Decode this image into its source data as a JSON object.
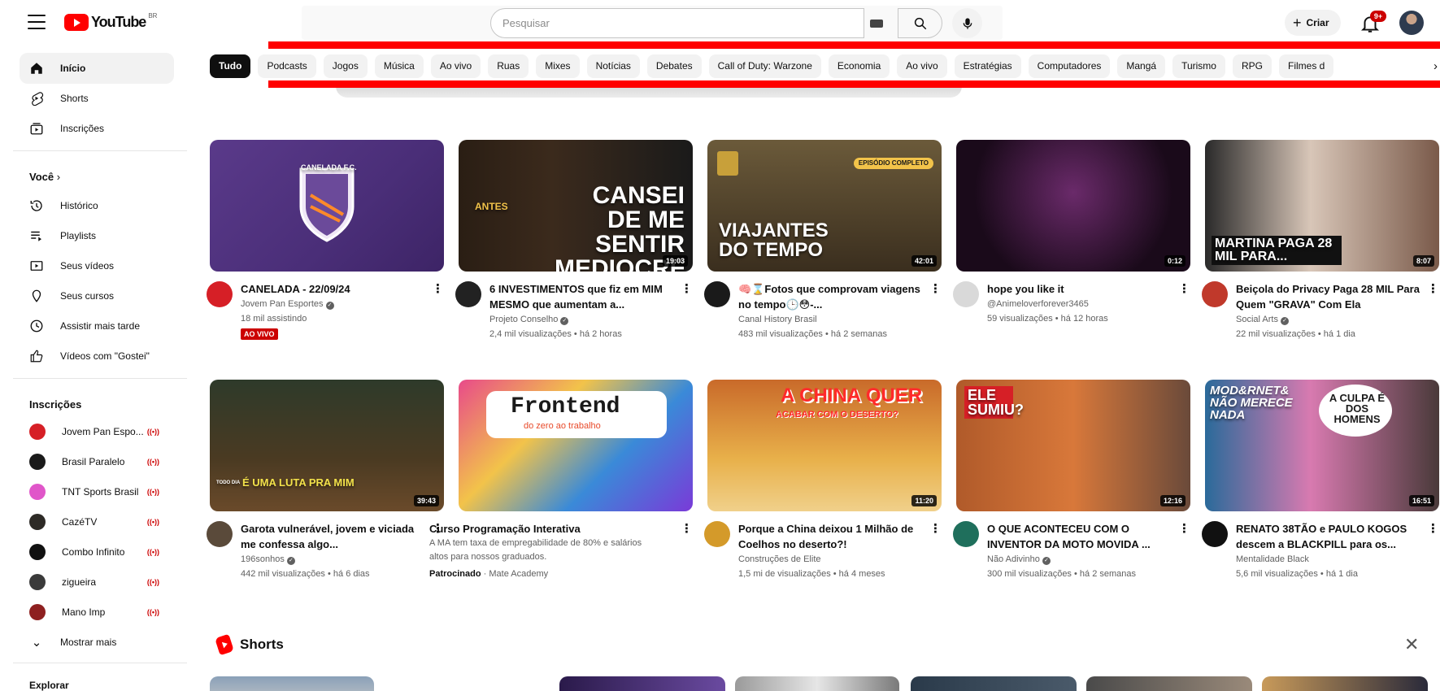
{
  "header": {
    "logo_text": "YouTube",
    "country_code": "BR",
    "search_placeholder": "Pesquisar",
    "create_label": "Criar",
    "notification_count": "9+"
  },
  "sidebar": {
    "main": [
      {
        "label": "Início",
        "icon": "home-icon",
        "active": true
      },
      {
        "label": "Shorts",
        "icon": "shorts-icon"
      },
      {
        "label": "Inscrições",
        "icon": "subscriptions-icon"
      }
    ],
    "you_heading": "Você",
    "you_items": [
      {
        "label": "Histórico",
        "icon": "history-icon"
      },
      {
        "label": "Playlists",
        "icon": "playlists-icon"
      },
      {
        "label": "Seus vídeos",
        "icon": "your-videos-icon"
      },
      {
        "label": "Seus cursos",
        "icon": "courses-icon"
      },
      {
        "label": "Assistir mais tarde",
        "icon": "watch-later-icon"
      },
      {
        "label": "Vídeos com \"Gostei\"",
        "icon": "liked-icon"
      }
    ],
    "subs_heading": "Inscrições",
    "subs": [
      {
        "label": "Jovem Pan Espo...",
        "color": "#d61f26",
        "live": true
      },
      {
        "label": "Brasil Paralelo",
        "color": "#1a1a1a",
        "live": true
      },
      {
        "label": "TNT Sports Brasil",
        "color": "#e056c9",
        "live": true
      },
      {
        "label": "CazéTV",
        "color": "#2d2a26",
        "live": true
      },
      {
        "label": "Combo Infinito",
        "color": "#111111",
        "live": true
      },
      {
        "label": "zigueira",
        "color": "#3a3a3a",
        "live": true
      },
      {
        "label": "Mano Imp",
        "color": "#8e2020",
        "live": true
      }
    ],
    "show_more": "Mostrar mais",
    "explore_heading": "Explorar"
  },
  "chips": [
    "Tudo",
    "Podcasts",
    "Jogos",
    "Música",
    "Ao vivo",
    "Ruas",
    "Mixes",
    "Notícias",
    "Debates",
    "Call of Duty: Warzone",
    "Economia",
    "Ao vivo",
    "Estratégias",
    "Computadores",
    "Mangá",
    "Turismo",
    "RPG",
    "Filmes d"
  ],
  "videos": [
    {
      "title": "CANELADA - 22/09/24",
      "channel": "Jovem Pan Esportes",
      "verified": true,
      "stats": "18 mil assistindo",
      "live_badge": "AO VIVO",
      "duration": "",
      "thumb_text": "CANELADA F.C.",
      "avatar_color": "#d61f26"
    },
    {
      "title": "6 INVESTIMENTOS que fiz em MIM MESMO que aumentam a...",
      "channel": "Projeto Conselho",
      "verified": true,
      "stats": "2,4 mil visualizações • há 2 horas",
      "duration": "19:03",
      "thumb_text": "CANSEI DE ME SENTIR MEDIOCRE",
      "thumb_extra": "ANTES",
      "avatar_color": "#222222"
    },
    {
      "title": "🧠⌛Fotos que comprovam viagens no tempo🕒😳-...",
      "channel": "Canal History Brasil",
      "verified": false,
      "stats": "483 mil visualizações • há 2 semanas",
      "duration": "42:01",
      "thumb_text": "VIAJANTES DO TEMPO",
      "thumb_extra": "EPISÓDIO COMPLETO",
      "avatar_color": "#1a1a1a"
    },
    {
      "title": "hope you like it",
      "channel": "@Animeloverforever3465",
      "verified": false,
      "stats": "59 visualizações • há 12 horas",
      "duration": "0:12",
      "thumb_text": "",
      "avatar_color": "#d9d9d9"
    },
    {
      "title": "Beiçola do Privacy Paga 28 MIL Para Quem \"GRAVA\" Com Ela",
      "channel": "Social Arts",
      "verified": true,
      "stats": "22 mil visualizações • há 1 dia",
      "duration": "8:07",
      "thumb_text": "MARTINA PAGA 28 MIL PARA...",
      "avatar_color": "#c0392b"
    },
    {
      "title": "Garota vulnerável, jovem e viciada me confessa algo...",
      "channel": "196sonhos",
      "verified": true,
      "stats": "442 mil visualizações • há 6 dias",
      "duration": "39:43",
      "thumb_text": "É UMA LUTA PRA MIM",
      "thumb_extra": "TODO DIA",
      "avatar_color": "#5a4a3a"
    },
    {
      "title": "Curso Programação Interativa",
      "channel": "Mate Academy",
      "sponsored_label": "Patrocinado",
      "ad_desc": "A MA tem taxa de empregabilidade de 80% e salários altos para nossos graduados.",
      "duration": "",
      "thumb_text": "Frontend",
      "thumb_extra": "do zero ao trabalho",
      "avatar_color": ""
    },
    {
      "title": "Porque a China deixou 1 Milhão de Coelhos no deserto?!",
      "channel": "Construções de Elite",
      "verified": false,
      "stats": "1,5 mi de visualizações • há 4 meses",
      "duration": "11:20",
      "thumb_text": "A CHINA QUER",
      "thumb_extra": "ACABAR COM O DESERTO?",
      "avatar_color": "#d49a2a"
    },
    {
      "title": "O QUE ACONTECEU COM O INVENTOR DA MOTO MOVIDA ...",
      "channel": "Não Adivinho",
      "verified": true,
      "stats": "300 mil visualizações • há 2 semanas",
      "duration": "12:16",
      "thumb_text": "ELE SUMIU?",
      "avatar_color": "#1f6f5c"
    },
    {
      "title": "RENATO 38TÃO e PAULO KOGOS descem a BLACKPILL para os...",
      "channel": "Mentalidade Black",
      "verified": false,
      "stats": "5,6 mil visualizações • há 1 dia",
      "duration": "16:51",
      "thumb_text": "MOD&RNET& NÃO MERECE NADA",
      "thumb_extra": "A CULPA É DOS HOMENS",
      "avatar_color": "#111111"
    }
  ],
  "shorts": {
    "heading": "Shorts"
  },
  "colors": {
    "accent": "#ff0000",
    "live": "#cc0000",
    "chip_bg": "#f2f2f2",
    "text_secondary": "#606060"
  }
}
